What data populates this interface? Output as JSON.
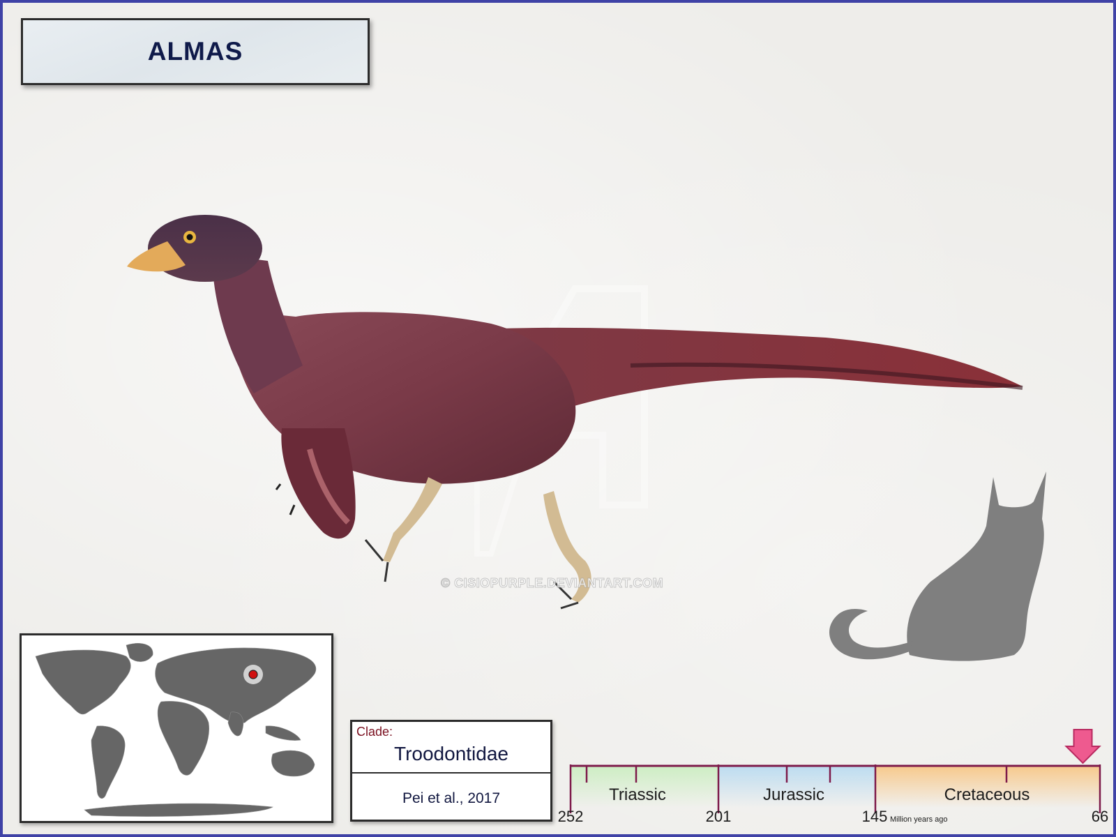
{
  "title": "ALMAS",
  "watermark": "© CISIOPURPLE.DEVIANTART.COM",
  "clade": {
    "label": "Clade:",
    "name": "Troodontidae",
    "citation": "Pei et al., 2017"
  },
  "timeline": {
    "periods": [
      "Triassic",
      "Jurassic",
      "Cretaceous"
    ],
    "ticks": [
      "252",
      "201",
      "145",
      "66"
    ],
    "unit": "Million years ago",
    "marker_ma": 72,
    "colors": {
      "triassic": "#cdeec3",
      "jurassic": "#bcdcf0",
      "cretaceous": "#f7c98c",
      "axis": "#7d1a4a",
      "marker": "#ee5a8f"
    }
  },
  "map": {
    "location_marker_color": "#d01010"
  },
  "colors": {
    "frame": "#3f42a6",
    "title_text": "#0f1a4a",
    "silhouette": "#7f7f7f",
    "dinosaur": "#7c3a46"
  }
}
